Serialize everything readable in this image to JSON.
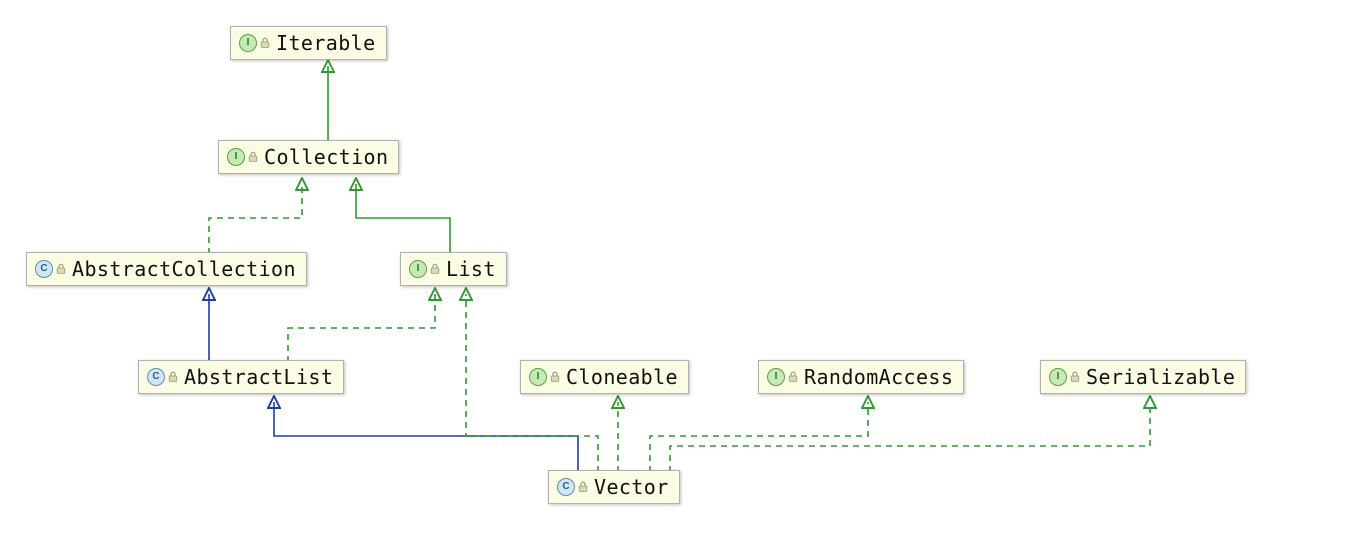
{
  "diagram": {
    "kind": "class-hierarchy",
    "nodes": {
      "iterable": {
        "type": "interface",
        "label": "Iterable"
      },
      "collection": {
        "type": "interface",
        "label": "Collection"
      },
      "abstract_collection": {
        "type": "class",
        "label": "AbstractCollection"
      },
      "list": {
        "type": "interface",
        "label": "List"
      },
      "abstract_list": {
        "type": "class",
        "label": "AbstractList"
      },
      "cloneable": {
        "type": "interface",
        "label": "Cloneable"
      },
      "random_access": {
        "type": "interface",
        "label": "RandomAccess"
      },
      "serializable": {
        "type": "interface",
        "label": "Serializable"
      },
      "vector": {
        "type": "class",
        "label": "Vector"
      }
    },
    "edges": [
      {
        "from": "collection",
        "to": "iterable",
        "kind": "implements"
      },
      {
        "from": "abstract_collection",
        "to": "collection",
        "kind": "implements"
      },
      {
        "from": "list",
        "to": "collection",
        "kind": "implements"
      },
      {
        "from": "abstract_list",
        "to": "abstract_collection",
        "kind": "extends"
      },
      {
        "from": "abstract_list",
        "to": "list",
        "kind": "implements"
      },
      {
        "from": "vector",
        "to": "abstract_list",
        "kind": "extends"
      },
      {
        "from": "vector",
        "to": "list",
        "kind": "implements"
      },
      {
        "from": "vector",
        "to": "cloneable",
        "kind": "implements"
      },
      {
        "from": "vector",
        "to": "random_access",
        "kind": "implements"
      },
      {
        "from": "vector",
        "to": "serializable",
        "kind": "implements"
      }
    ],
    "colors": {
      "node_bg": "#fbfce4",
      "node_border": "#b0b0b0",
      "interface_arrow": "#2e9a2e",
      "class_arrow": "#1b3f9c",
      "interface_badge_bg": "#c7e8b7",
      "class_badge_bg": "#cfe7f5"
    }
  }
}
